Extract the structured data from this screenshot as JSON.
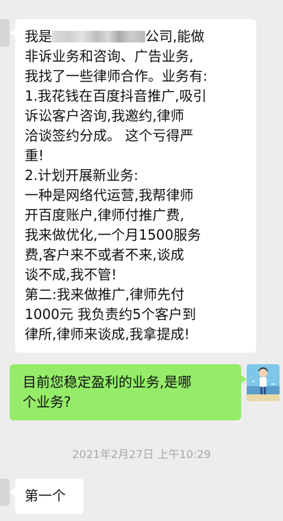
{
  "messages": [
    {
      "direction": "incoming",
      "lines_before": [
        "非诉业务和咨询、广告业务,",
        "我找了一些律师合作。业务有:",
        "1.我花钱在百度抖音推广,吸引",
        "诉讼客户咨询,我邀约,律师",
        "洽谈签约分成。 这个亏得严",
        "重!",
        "2.计划开展新业务:",
        "一种是网络代运营,我帮律师",
        "开百度账户,律师付推广费,",
        "我来做优化,一个月1500服务",
        "费,客户来不或者不来,谈成",
        "谈不成,我不管!",
        "第二:我来做推广,律师先付",
        "1000元  我负责约5个客户到",
        "律所,律师来谈成,我拿提成!"
      ],
      "first_line_prefix": "我是",
      "first_line_suffix": "公司,能做"
    },
    {
      "direction": "outgoing",
      "lines": [
        "目前您稳定盈利的业务,是哪",
        "个业务?"
      ]
    },
    {
      "direction": "incoming",
      "lines": [
        "第一个"
      ]
    }
  ],
  "timestamp": "2021年2月27日 上午10:29",
  "colors": {
    "background": "#ededed",
    "incoming_bubble": "#ffffff",
    "outgoing_bubble": "#95ec69",
    "timestamp_text": "#a8a8a8"
  }
}
